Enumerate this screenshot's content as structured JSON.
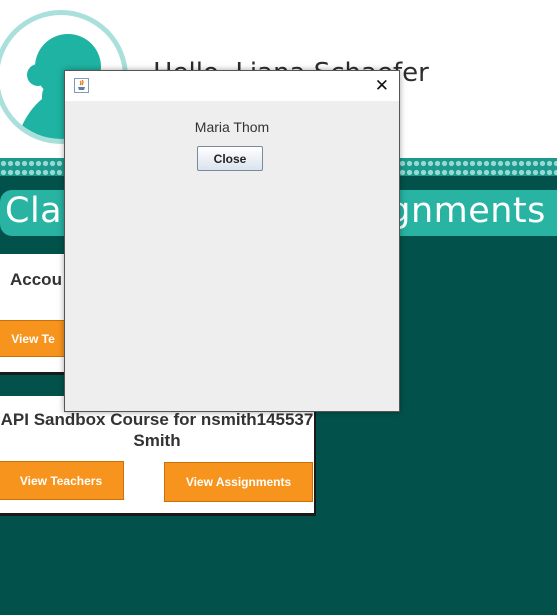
{
  "header": {
    "greeting": "Hello,  Liana Schaefer"
  },
  "banner": {
    "title_left": "Clas",
    "title_right": "ignments"
  },
  "cards": [
    {
      "title": "Accou",
      "teachers_button": "View Te"
    },
    {
      "title": "API Sandbox Course for nsmith145537 Smith",
      "teachers_button": "View Teachers",
      "assignments_button": "View Assignments"
    }
  ],
  "dialog": {
    "name": "Maria Thom",
    "close_button": "Close",
    "close_icon": "close-icon",
    "title_icon": "java-icon"
  },
  "colors": {
    "background": "#02524b",
    "accent": "#28b3a2",
    "button_orange": "#f7941d"
  }
}
